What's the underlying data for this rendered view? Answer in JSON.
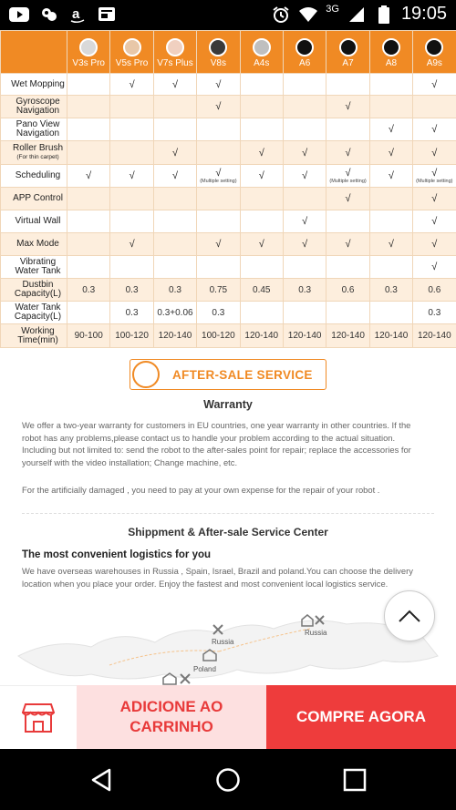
{
  "status_bar": {
    "left_icons": [
      "youtube-icon",
      "gallery-icon",
      "amazon-icon",
      "news-icon"
    ],
    "right_icons": [
      "alarm-icon",
      "wifi-icon",
      "signal-icon",
      "battery-icon"
    ],
    "network": "3G",
    "time": "19:05"
  },
  "table": {
    "models": [
      {
        "name": "V3s Pro",
        "color": "#d9d9d9"
      },
      {
        "name": "V5s Pro",
        "color": "#e8c7a8"
      },
      {
        "name": "V7s Plus",
        "color": "#f0d0c0"
      },
      {
        "name": "V8s",
        "color": "#3a3a3a"
      },
      {
        "name": "A4s",
        "color": "#bfbfbf"
      },
      {
        "name": "A6",
        "color": "#111111"
      },
      {
        "name": "A7",
        "color": "#111111"
      },
      {
        "name": "A8",
        "color": "#111111"
      },
      {
        "name": "A9s",
        "color": "#111111"
      }
    ],
    "rows": [
      {
        "feature": "Wet Mopping",
        "note": "",
        "cells": [
          "",
          "√",
          "√",
          "√",
          "",
          "",
          "",
          "",
          "√"
        ]
      },
      {
        "feature": "Gyroscope Navigation",
        "note": "",
        "cells": [
          "",
          "",
          "",
          "√",
          "",
          "",
          "√",
          "",
          ""
        ]
      },
      {
        "feature": "Pano View Navigation",
        "note": "",
        "cells": [
          "",
          "",
          "",
          "",
          "",
          "",
          "",
          "√",
          "√"
        ]
      },
      {
        "feature": "Roller Brush",
        "note": "(For thin carpet)",
        "cells": [
          "",
          "",
          "√",
          "",
          "√",
          "√",
          "√",
          "√",
          "√"
        ]
      },
      {
        "feature": "Scheduling",
        "note": "",
        "cells": [
          "√",
          "√",
          "√",
          "√",
          "√",
          "√",
          "√",
          "√",
          "√"
        ],
        "subs": [
          "",
          "",
          "",
          "(Multiple setting)",
          "",
          "",
          "(Multiple setting)",
          "",
          "(Multiple setting)"
        ]
      },
      {
        "feature": "APP Control",
        "note": "",
        "cells": [
          "",
          "",
          "",
          "",
          "",
          "",
          "√",
          "",
          "√"
        ]
      },
      {
        "feature": "Virtual Wall",
        "note": "",
        "cells": [
          "",
          "",
          "",
          "",
          "",
          "√",
          "",
          "",
          "√"
        ]
      },
      {
        "feature": "Max Mode",
        "note": "",
        "cells": [
          "",
          "√",
          "",
          "√",
          "√",
          "√",
          "√",
          "√",
          "√"
        ]
      },
      {
        "feature": "Vibrating Water Tank",
        "note": "",
        "cells": [
          "",
          "",
          "",
          "",
          "",
          "",
          "",
          "",
          "√"
        ]
      },
      {
        "feature": "Dustbin Capacity(L)",
        "note": "",
        "cells": [
          "0.3",
          "0.3",
          "0.3",
          "0.75",
          "0.45",
          "0.3",
          "0.6",
          "0.3",
          "0.6"
        ]
      },
      {
        "feature": "Water Tank Capacity(L)",
        "note": "",
        "cells": [
          "",
          "0.3",
          "0.3+0.06",
          "0.3",
          "",
          "",
          "",
          "",
          "0.3"
        ]
      },
      {
        "feature": "Working Time(min)",
        "note": "",
        "cells": [
          "90-100",
          "100-120",
          "120-140",
          "100-120",
          "120-140",
          "120-140",
          "120-140",
          "120-140",
          "120-140"
        ]
      }
    ]
  },
  "after_sale": {
    "button_label": "AFTER-SALE SERVICE",
    "warranty_title": "Warranty",
    "warranty_text": "We offer a two-year warranty for customers in EU countries, one year warranty in other countries. If the robot has any problems,please contact us to handle your problem according to the actual situation. Including but not limited to: send the robot to the after-sales point for repair; replace the accessories for yourself with the video installation; Change machine, etc.",
    "damage_text": "For the artificially damaged , you need to pay at your own expense for the repair of your robot .",
    "shipment_title": "Shippment & After-sale Service Center",
    "logistics_title": "The most convenient logistics for you",
    "logistics_text": "We have overseas warehouses in Russia , Spain, Israel, Brazil and poland.You can choose the delivery location when you place your order. Enjoy the fastest and most convenient local logistics service."
  },
  "map": {
    "labels": [
      "Russia",
      "Russia",
      "Poland"
    ]
  },
  "actions": {
    "cart_label": "ADICIONE AO CARRINHO",
    "buy_label": "COMPRE AGORA",
    "store_icon": "store-icon"
  },
  "nav": {
    "icons": [
      "back-icon",
      "home-icon",
      "recents-icon"
    ]
  },
  "colors": {
    "accent": "#f08a24",
    "row_tint": "#fdeedd",
    "cart_bg": "#fde0e0",
    "buy_bg": "#ee3c3c"
  }
}
